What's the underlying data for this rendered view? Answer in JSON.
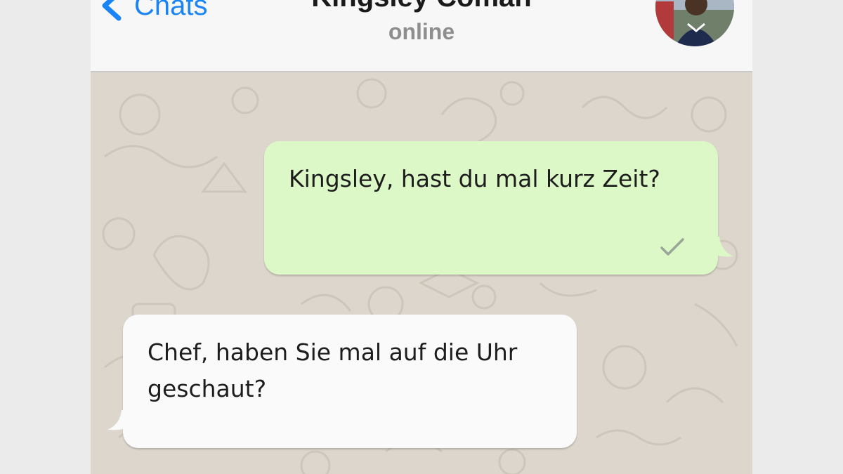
{
  "header": {
    "back_label": "Chats",
    "contact_name": "Kingsley Coman",
    "status": "online"
  },
  "messages": [
    {
      "direction": "outgoing",
      "text": "Kingsley, hast du mal kurz Zeit?",
      "receipt_icon": "single-check-icon"
    },
    {
      "direction": "incoming",
      "text": "Chef, haben Sie mal auf die Uhr geschaut?"
    }
  ],
  "colors": {
    "accent": "#1a84f6",
    "outgoing_bubble": "#dcf8c6",
    "incoming_bubble": "#fafafa",
    "chat_background": "#dcd6cc",
    "header_background": "#f7f7f7",
    "status_text": "#8e8e8e"
  }
}
